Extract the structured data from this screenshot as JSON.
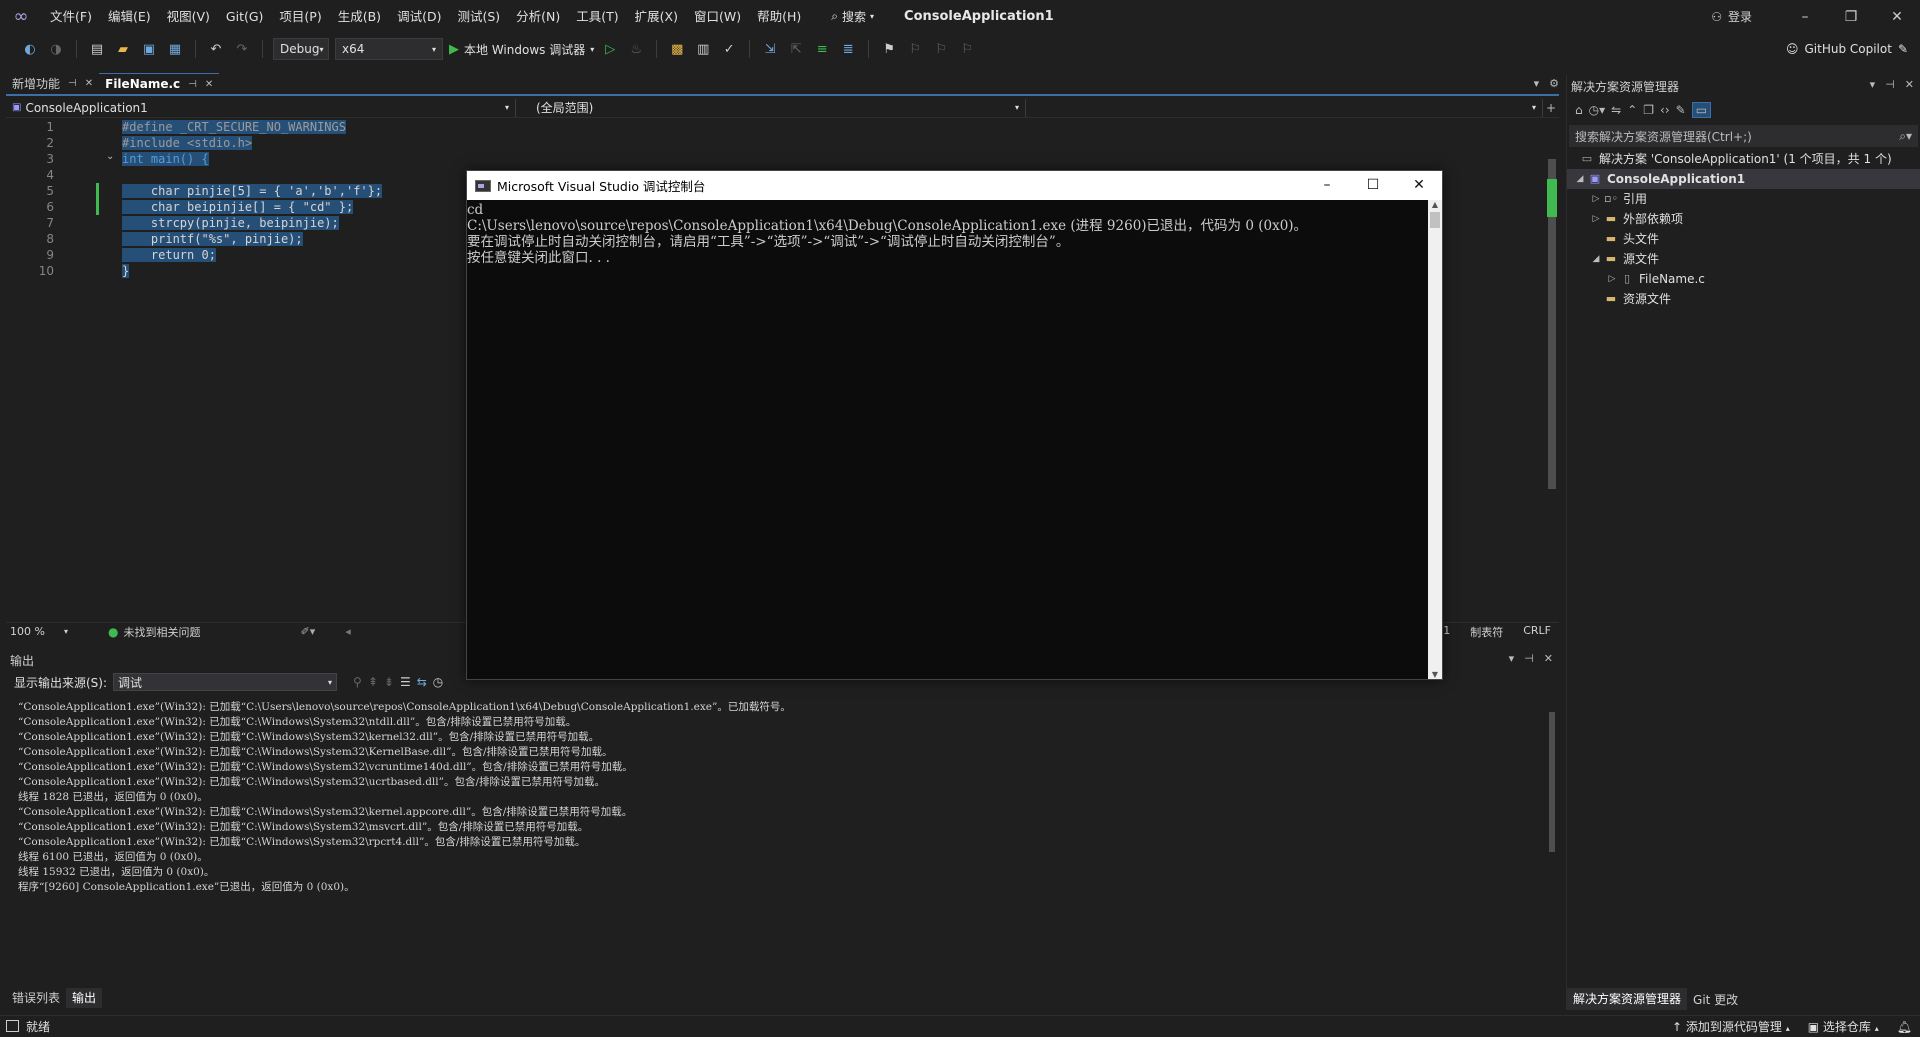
{
  "menubar": {
    "items": [
      "文件(F)",
      "编辑(E)",
      "视图(V)",
      "Git(G)",
      "项目(P)",
      "生成(B)",
      "调试(D)",
      "测试(S)",
      "分析(N)",
      "工具(T)",
      "扩展(X)",
      "窗口(W)",
      "帮助(H)"
    ],
    "search_label": "搜索",
    "solution_name": "ConsoleApplication1",
    "login_label": "登录"
  },
  "toolbar": {
    "config": "Debug",
    "platform": "x64",
    "run_label": "本地 Windows 调试器",
    "copilot_label": "GitHub Copilot"
  },
  "tabs": [
    {
      "label": "新增功能",
      "active": false
    },
    {
      "label": "FileName.c",
      "active": true
    }
  ],
  "navbar": {
    "project": "ConsoleApplication1",
    "scope": "(全局范围)"
  },
  "editor": {
    "line_numbers": [
      "1",
      "2",
      "3",
      "4",
      "5",
      "6",
      "7",
      "8",
      "9",
      "10"
    ],
    "lines": [
      "#define _CRT_SECURE_NO_WARNINGS",
      "#include <stdio.h>",
      "int main() {",
      "",
      "    char pinjie[5] = { 'a','b','f'};",
      "    char beipinjie[] = { \"cd\" };",
      "    strcpy(pinjie, beipinjie);",
      "    printf(\"%s\", pinjie);",
      "    return 0;",
      "}"
    ]
  },
  "editor_status": {
    "zoom": "100 %",
    "issues": "未找到相关问题",
    "line_info": "1",
    "indent": "制表符",
    "eol": "CRLF"
  },
  "output": {
    "title": "输出",
    "source_label": "显示输出来源(S):",
    "source_value": "调试",
    "lines": [
      "“ConsoleApplication1.exe”(Win32): 已加载“C:\\Users\\lenovo\\source\\repos\\ConsoleApplication1\\x64\\Debug\\ConsoleApplication1.exe”。已加载符号。",
      "“ConsoleApplication1.exe”(Win32): 已加载“C:\\Windows\\System32\\ntdll.dll”。包含/排除设置已禁用符号加载。",
      "“ConsoleApplication1.exe”(Win32): 已加载“C:\\Windows\\System32\\kernel32.dll”。包含/排除设置已禁用符号加载。",
      "“ConsoleApplication1.exe”(Win32): 已加载“C:\\Windows\\System32\\KernelBase.dll”。包含/排除设置已禁用符号加载。",
      "“ConsoleApplication1.exe”(Win32): 已加载“C:\\Windows\\System32\\vcruntime140d.dll”。包含/排除设置已禁用符号加载。",
      "“ConsoleApplication1.exe”(Win32): 已加载“C:\\Windows\\System32\\ucrtbased.dll”。包含/排除设置已禁用符号加载。",
      "线程 1828 已退出，返回值为 0 (0x0)。",
      "“ConsoleApplication1.exe”(Win32): 已加载“C:\\Windows\\System32\\kernel.appcore.dll”。包含/排除设置已禁用符号加载。",
      "“ConsoleApplication1.exe”(Win32): 已加载“C:\\Windows\\System32\\msvcrt.dll”。包含/排除设置已禁用符号加载。",
      "“ConsoleApplication1.exe”(Win32): 已加载“C:\\Windows\\System32\\rpcrt4.dll”。包含/排除设置已禁用符号加载。",
      "线程 6100 已退出，返回值为 0 (0x0)。",
      "线程 15932 已退出，返回值为 0 (0x0)。",
      "程序“[9260] ConsoleApplication1.exe”已退出，返回值为 0 (0x0)。"
    ],
    "bottom_tabs": [
      "错误列表",
      "输出"
    ]
  },
  "solution_explorer": {
    "title": "解决方案资源管理器",
    "search_placeholder": "搜索解决方案资源管理器(Ctrl+;)",
    "tree": [
      {
        "label": "解决方案 'ConsoleApplication1' (1 个项目，共 1 个)",
        "icon": "solution-icon"
      },
      {
        "label": "ConsoleApplication1",
        "icon": "project-icon"
      },
      {
        "label": "引用",
        "icon": "references-icon"
      },
      {
        "label": "外部依赖项",
        "icon": "folder-icon"
      },
      {
        "label": "头文件",
        "icon": "folder-icon"
      },
      {
        "label": "源文件",
        "icon": "folder-icon"
      },
      {
        "label": "FileName.c",
        "icon": "c-file-icon"
      },
      {
        "label": "资源文件",
        "icon": "folder-icon"
      }
    ],
    "footer_tabs": [
      "解决方案资源管理器",
      "Git 更改"
    ]
  },
  "statusbar": {
    "ready": "就绪",
    "add_to_source": "添加到源代码管理",
    "select_repo": "选择仓库"
  },
  "console": {
    "title": "Microsoft Visual Studio 调试控制台",
    "lines": [
      "cd",
      "C:\\Users\\lenovo\\source\\repos\\ConsoleApplication1\\x64\\Debug\\ConsoleApplication1.exe (进程 9260)已退出，代码为 0 (0x0)。",
      "要在调试停止时自动关闭控制台，请启用“工具”->“选项”->“调试”->“调试停止时自动关闭控制台”。",
      "按任意键关闭此窗口. . ."
    ]
  }
}
